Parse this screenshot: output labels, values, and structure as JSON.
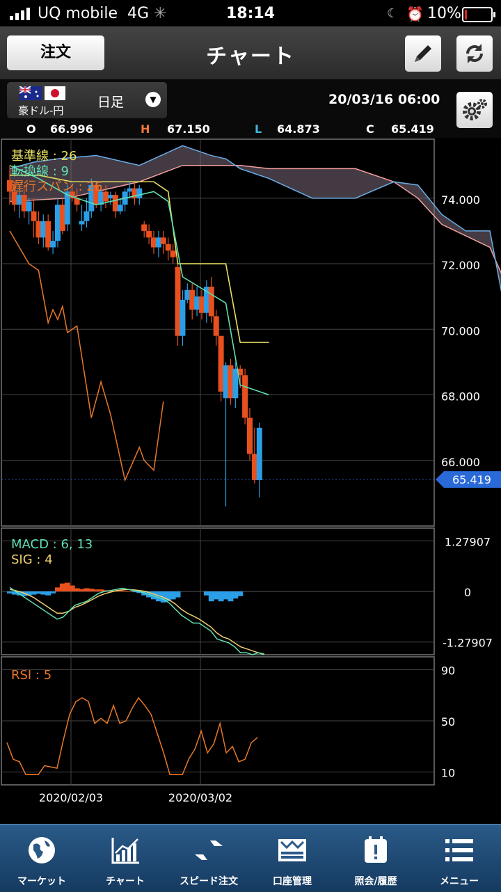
{
  "status_bar": {
    "carrier": "UQ mobile",
    "network": "4G",
    "time": "18:14",
    "battery": "10%",
    "battery_level": 0.1
  },
  "nav": {
    "order_button": "注文",
    "title": "チャート",
    "edit_icon": "pencil-icon",
    "refresh_icon": "refresh-icon"
  },
  "instrument": {
    "pair": "豪ドル-円",
    "timeframe": "日足",
    "datetime": "20/03/16  06:00",
    "flags": [
      "australia-flag",
      "japan-flag"
    ]
  },
  "ohlc": {
    "o_label": "O",
    "o": "66.996",
    "h_label": "H",
    "h": "67.150",
    "l_label": "L",
    "l": "64.873",
    "c_label": "C",
    "c": "65.419"
  },
  "colors": {
    "up": "#2a9ee6",
    "down": "#e8501e",
    "kijun": "#e8e060",
    "tenkan": "#60e0b0",
    "chikou": "#e87828",
    "span_upper": "#f4a0a0",
    "span_lower": "#6aaee8",
    "price_badge": "#2a6ad8",
    "macd": "#60e0b0",
    "signal": "#f0d070",
    "rsi": "#e87828"
  },
  "chart_data": [
    {
      "type": "candlestick",
      "name": "main",
      "indicators": {
        "kijun_label": "基準線 : 26",
        "tenkan_label": "転換線 : 9",
        "chikou_label": "遅行スパン : 26"
      },
      "y_ticks": [
        "74.000",
        "72.000",
        "70.000",
        "68.000",
        "66.000"
      ],
      "ylim": [
        64.0,
        75.8
      ],
      "current_price": "65.419",
      "x_ticks": [
        "2020/02/03",
        "2020/03/02"
      ],
      "candles": [
        [
          74.55,
          74.2,
          75.0,
          73.8
        ],
        [
          74.2,
          73.8,
          74.5,
          73.6
        ],
        [
          73.8,
          74.1,
          74.3,
          73.4
        ],
        [
          74.1,
          73.6,
          74.4,
          73.4
        ],
        [
          73.6,
          73.9,
          74.0,
          73.2
        ],
        [
          73.6,
          73.3,
          74.0,
          72.8
        ],
        [
          73.3,
          72.8,
          73.6,
          72.6
        ],
        [
          72.8,
          73.3,
          73.5,
          72.5
        ],
        [
          73.3,
          72.5,
          73.5,
          72.4
        ],
        [
          72.5,
          72.7,
          73.0,
          72.3
        ],
        [
          72.7,
          73.8,
          74.0,
          72.5
        ],
        [
          73.8,
          73.0,
          74.0,
          72.9
        ],
        [
          73.2,
          74.2,
          74.4,
          73.0
        ],
        [
          74.2,
          74.0,
          74.4,
          73.9
        ],
        [
          74.0,
          73.8,
          74.3,
          73.6
        ],
        [
          73.2,
          73.3,
          73.8,
          73.0
        ],
        [
          73.3,
          73.6,
          74.0,
          73.1
        ],
        [
          73.6,
          74.4,
          74.6,
          73.4
        ],
        [
          74.4,
          73.8,
          74.5,
          73.7
        ],
        [
          73.8,
          74.2,
          74.4,
          73.6
        ],
        [
          74.2,
          73.9,
          74.4,
          73.7
        ],
        [
          74.0,
          74.1,
          74.2,
          73.8
        ],
        [
          74.1,
          73.6,
          74.2,
          73.4
        ],
        [
          73.6,
          73.8,
          74.0,
          73.5
        ],
        [
          73.8,
          74.2,
          74.3,
          73.6
        ],
        [
          74.2,
          74.3,
          74.5,
          74.0
        ],
        [
          74.3,
          74.0,
          74.5,
          73.8
        ],
        [
          74.0,
          74.3,
          74.4,
          73.8
        ],
        [
          73.2,
          73.0,
          73.3,
          72.8
        ],
        [
          73.0,
          72.8,
          73.2,
          72.6
        ],
        [
          72.8,
          72.5,
          73.0,
          72.3
        ],
        [
          72.5,
          72.8,
          73.0,
          72.2
        ],
        [
          72.8,
          72.6,
          73.0,
          72.3
        ],
        [
          72.6,
          72.4,
          72.8,
          72.1
        ],
        [
          72.4,
          72.2,
          72.6,
          72.0
        ],
        [
          71.9,
          69.8,
          72.0,
          69.5
        ],
        [
          69.8,
          70.9,
          71.2,
          69.5
        ],
        [
          70.9,
          71.2,
          71.4,
          70.8
        ],
        [
          71.2,
          70.6,
          71.4,
          70.3
        ],
        [
          70.6,
          71.0,
          71.3,
          70.4
        ],
        [
          71.0,
          70.5,
          71.2,
          70.3
        ],
        [
          70.5,
          71.3,
          71.5,
          70.2
        ],
        [
          71.3,
          70.4,
          71.6,
          70.2
        ],
        [
          70.4,
          69.8,
          70.6,
          69.5
        ],
        [
          69.8,
          68.1,
          68.8,
          67.8
        ],
        [
          67.9,
          68.9,
          69.0,
          64.6
        ],
        [
          68.9,
          67.9,
          69.1,
          67.7
        ],
        [
          67.9,
          68.8,
          69.0,
          67.6
        ],
        [
          68.8,
          68.6,
          68.9,
          68.2
        ],
        [
          68.6,
          67.3,
          68.8,
          67.1
        ],
        [
          67.3,
          66.2,
          67.6,
          66.0
        ],
        [
          66.2,
          65.4,
          67.0,
          65.3
        ],
        [
          65.4,
          66.996,
          67.15,
          64.873
        ]
      ],
      "kijun": [
        [
          0,
          74.7
        ],
        [
          6,
          74.7
        ],
        [
          13,
          74.5
        ],
        [
          30,
          74.5
        ],
        [
          33,
          74.2
        ],
        [
          35,
          72.0
        ],
        [
          45,
          72.0
        ],
        [
          48,
          69.6
        ],
        [
          54,
          69.6
        ]
      ],
      "tenkan": [
        [
          0,
          75.0
        ],
        [
          6,
          74.6
        ],
        [
          12,
          74.1
        ],
        [
          18,
          73.8
        ],
        [
          24,
          74.0
        ],
        [
          30,
          74.2
        ],
        [
          33,
          73.9
        ],
        [
          36,
          71.6
        ],
        [
          45,
          70.8
        ],
        [
          48,
          68.3
        ],
        [
          54,
          68.0
        ]
      ],
      "chikou": [
        [
          0,
          73.0
        ],
        [
          4,
          72.0
        ],
        [
          6,
          71.8
        ],
        [
          8,
          70.2
        ],
        [
          9,
          70.6
        ],
        [
          10,
          70.3
        ],
        [
          11,
          70.7
        ],
        [
          12,
          69.9
        ],
        [
          14,
          70.1
        ],
        [
          17,
          67.3
        ],
        [
          19,
          68.4
        ],
        [
          21,
          67.4
        ],
        [
          24,
          65.4
        ],
        [
          27,
          66.4
        ],
        [
          28,
          66.0
        ],
        [
          30,
          65.7
        ],
        [
          32,
          67.8
        ]
      ],
      "span_a": [
        [
          0,
          74.9
        ],
        [
          5,
          75.1
        ],
        [
          10,
          75.2
        ],
        [
          18,
          75.3
        ],
        [
          27,
          75.0
        ],
        [
          36,
          75.6
        ],
        [
          42,
          75.3
        ],
        [
          45,
          75.2
        ],
        [
          48,
          74.9
        ],
        [
          54,
          74.6
        ],
        [
          63,
          74.0
        ],
        [
          72,
          74.0
        ],
        [
          80,
          74.5
        ],
        [
          85,
          74.4
        ],
        [
          90,
          73.5
        ],
        [
          95,
          73.0
        ],
        [
          100,
          73.0
        ],
        [
          103,
          70.7
        ],
        [
          110,
          70.6
        ]
      ],
      "span_b": [
        [
          0,
          73.9
        ],
        [
          12,
          74.0
        ],
        [
          27,
          74.5
        ],
        [
          36,
          75.0
        ],
        [
          48,
          75.0
        ],
        [
          54,
          74.9
        ],
        [
          63,
          74.9
        ],
        [
          72,
          74.9
        ],
        [
          80,
          74.5
        ],
        [
          85,
          74.0
        ],
        [
          90,
          73.2
        ],
        [
          100,
          72.5
        ],
        [
          103,
          71.5
        ],
        [
          110,
          70.3
        ]
      ]
    },
    {
      "type": "bar+line",
      "name": "macd",
      "label_macd": "MACD : 6, 13",
      "label_sig": "SIG : 4",
      "y_ticks": [
        "1.27907",
        "0",
        "-1.27907"
      ],
      "ylim": [
        -1.6,
        1.6
      ],
      "histogram": [
        -0.05,
        -0.08,
        -0.1,
        -0.12,
        -0.1,
        -0.08,
        -0.06,
        -0.08,
        -0.1,
        -0.05,
        0.1,
        0.2,
        0.22,
        0.15,
        0.08,
        0.06,
        0.08,
        0.07,
        0.05,
        0.05,
        0.03,
        0.02,
        0.01,
        0.03,
        0.02,
        0.01,
        -0.02,
        -0.04,
        -0.1,
        -0.15,
        -0.2,
        -0.25,
        -0.28,
        -0.25,
        -0.2,
        -0.15,
        0,
        0,
        0,
        0,
        0,
        -0.1,
        -0.25,
        -0.2,
        -0.25,
        -0.2,
        -0.25,
        -0.18,
        -0.12
      ],
      "macd": [
        0.1,
        0.0,
        -0.1,
        -0.2,
        -0.3,
        -0.4,
        -0.5,
        -0.6,
        -0.7,
        -0.65,
        -0.5,
        -0.35,
        -0.3,
        -0.25,
        -0.15,
        -0.05,
        0.0,
        0.02,
        0.05,
        0.08,
        0.05,
        0.02,
        0.0,
        -0.05,
        -0.1,
        -0.15,
        -0.2,
        -0.3,
        -0.45,
        -0.6,
        -0.7,
        -0.8,
        -0.8,
        -0.9,
        -1.0,
        -1.2,
        -1.25,
        -1.3,
        -1.4,
        -1.55,
        -1.55,
        -1.6,
        -1.55,
        -1.6
      ],
      "signal": [
        0.05,
        0.02,
        -0.02,
        -0.08,
        -0.15,
        -0.25,
        -0.35,
        -0.45,
        -0.55,
        -0.55,
        -0.5,
        -0.4,
        -0.35,
        -0.28,
        -0.2,
        -0.12,
        -0.06,
        -0.02,
        0.02,
        0.04,
        0.05,
        0.04,
        0.02,
        0.0,
        -0.05,
        -0.1,
        -0.15,
        -0.22,
        -0.32,
        -0.45,
        -0.55,
        -0.62,
        -0.7,
        -0.8,
        -0.9,
        -1.05,
        -1.15,
        -1.2,
        -1.3,
        -1.4,
        -1.45,
        -1.5,
        -1.55,
        -1.58
      ]
    },
    {
      "type": "line",
      "name": "rsi",
      "label": "RSI : 5",
      "y_ticks": [
        "90",
        "50",
        "10"
      ],
      "ylim": [
        0,
        100
      ],
      "values": [
        33,
        20,
        18,
        8,
        8,
        8,
        15,
        14,
        13,
        35,
        55,
        65,
        68,
        65,
        48,
        52,
        48,
        62,
        48,
        50,
        60,
        68,
        62,
        55,
        40,
        25,
        8,
        8,
        8,
        20,
        28,
        42,
        25,
        32,
        48,
        25,
        30,
        18,
        20,
        33,
        37
      ]
    }
  ],
  "tabs": [
    {
      "label": "マーケット",
      "icon": "globe-icon"
    },
    {
      "label": "チャート",
      "icon": "chart-icon"
    },
    {
      "label": "スピード注文",
      "icon": "speed-arrows-icon"
    },
    {
      "label": "口座管理",
      "icon": "account-icon"
    },
    {
      "label": "照会/履歴",
      "icon": "calendar-icon"
    },
    {
      "label": "メニュー",
      "icon": "menu-icon"
    }
  ]
}
